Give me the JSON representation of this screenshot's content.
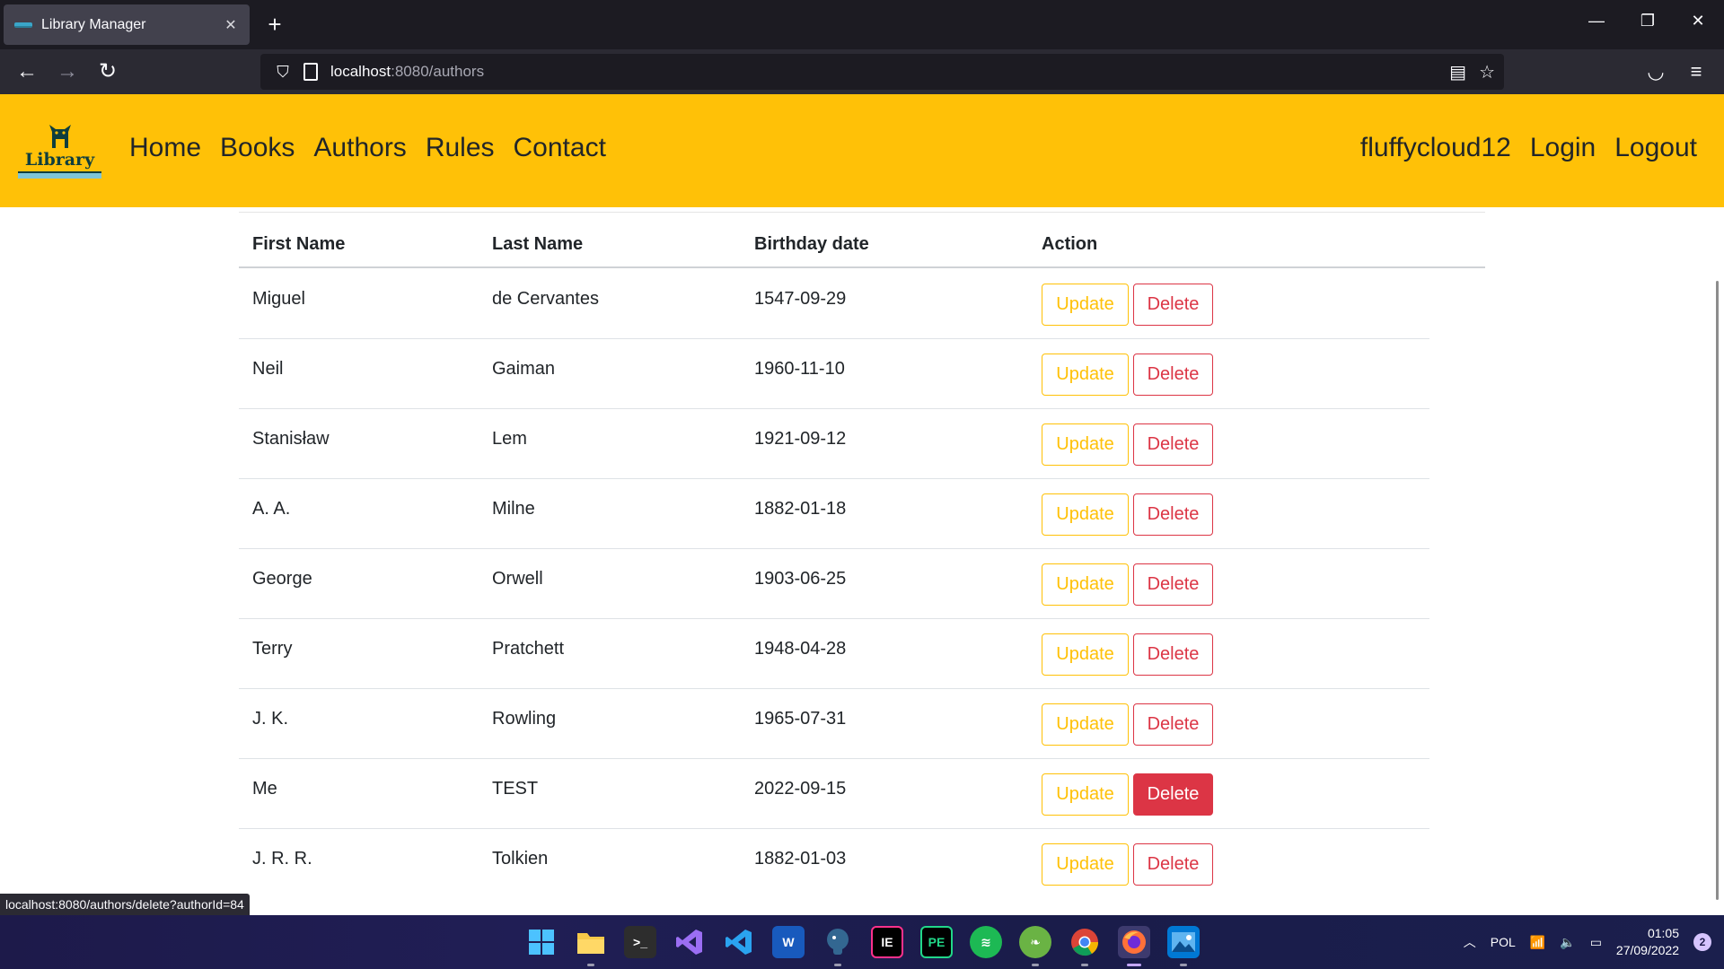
{
  "browser": {
    "tab_title": "Library Manager",
    "new_tab": "+",
    "url_host": "localhost",
    "url_rest": ":8080/authors",
    "status_url": "localhost:8080/authors/delete?authorId=84"
  },
  "site": {
    "logo_text": "Library",
    "nav_left": [
      "Home",
      "Books",
      "Authors",
      "Rules",
      "Contact"
    ],
    "username": "fluffycloud12",
    "login": "Login",
    "logout": "Logout"
  },
  "table": {
    "headers": [
      "First Name",
      "Last Name",
      "Birthday date",
      "Action"
    ],
    "update_label": "Update",
    "delete_label": "Delete",
    "rows": [
      {
        "first": "Miguel",
        "last": "de Cervantes",
        "birthday": "1547-09-29"
      },
      {
        "first": "Neil",
        "last": "Gaiman",
        "birthday": "1960-11-10"
      },
      {
        "first": "Stanisław",
        "last": "Lem",
        "birthday": "1921-09-12"
      },
      {
        "first": "A. A.",
        "last": "Milne",
        "birthday": "1882-01-18"
      },
      {
        "first": "George",
        "last": "Orwell",
        "birthday": "1903-06-25"
      },
      {
        "first": "Terry",
        "last": "Pratchett",
        "birthday": "1948-04-28"
      },
      {
        "first": "J. K.",
        "last": "Rowling",
        "birthday": "1965-07-31"
      },
      {
        "first": "Me",
        "last": "TEST",
        "birthday": "2022-09-15"
      },
      {
        "first": "J. R. R.",
        "last": "Tolkien",
        "birthday": "1882-01-03"
      }
    ]
  },
  "taskbar": {
    "language": "POL",
    "time": "01:05",
    "date": "27/09/2022",
    "notifications": "2"
  },
  "colors": {
    "header_bg": "#ffc107",
    "update_color": "#ffc107",
    "delete_color": "#dc3545"
  }
}
